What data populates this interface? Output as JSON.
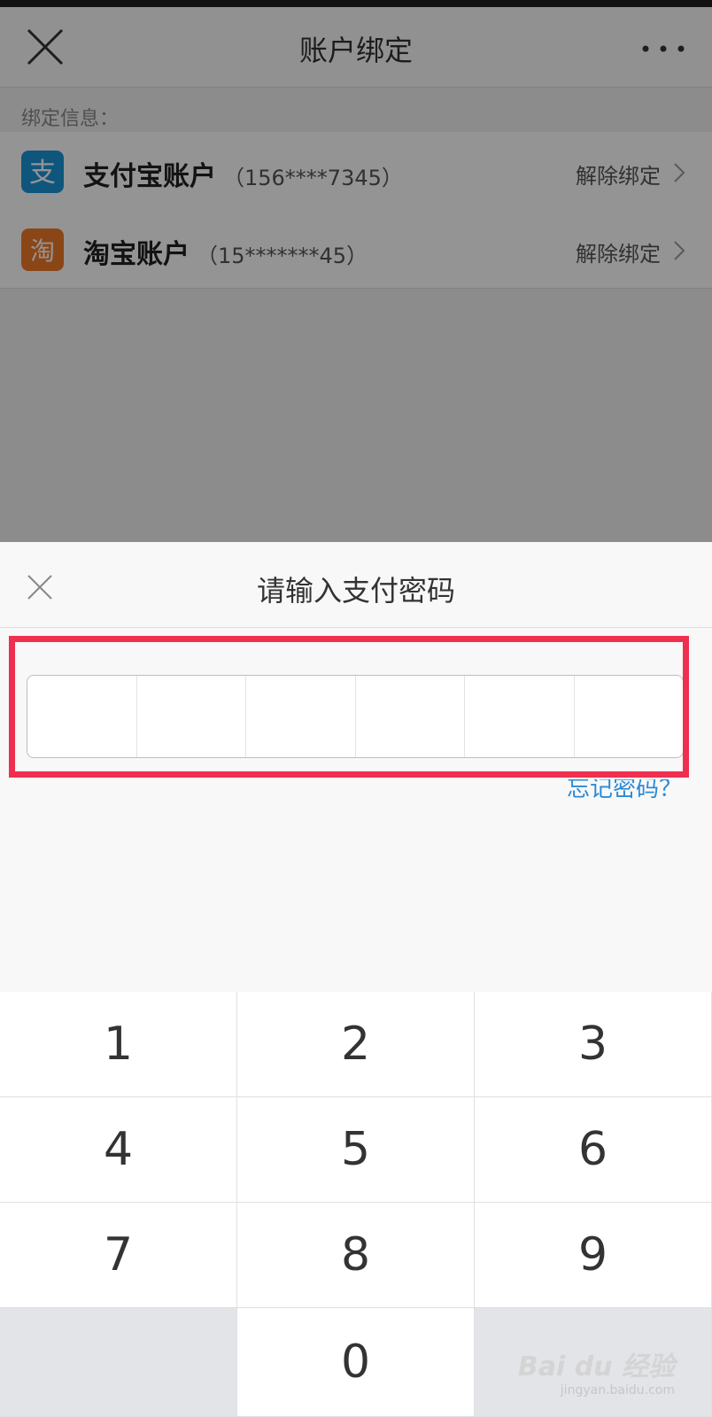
{
  "nav": {
    "title": "账户绑定",
    "close_icon": "close-icon",
    "more_icon": "more-icon"
  },
  "binding": {
    "section_label": "绑定信息：",
    "accounts": [
      {
        "name": "支付宝账户",
        "number": "（156****7345）",
        "action": "解除绑定",
        "icon": "alipay-logo",
        "color": "#1a95d8",
        "glyph": "支"
      },
      {
        "name": "淘宝账户",
        "number": "（15*******45）",
        "action": "解除绑定",
        "icon": "taobao-logo",
        "color": "#f0792a",
        "glyph": "淘"
      }
    ]
  },
  "dialog": {
    "title": "请输入支付密码",
    "close_icon": "close-icon",
    "password_cells": 6,
    "forgot_link": "忘记密码？",
    "highlight_color": "#ef2f4f"
  },
  "keypad": {
    "keys": [
      "1",
      "2",
      "3",
      "4",
      "5",
      "6",
      "7",
      "8",
      "9",
      "",
      "0",
      ""
    ]
  },
  "watermark": {
    "brand": "Bai du 经验",
    "url": "jingyan.baidu.com"
  }
}
